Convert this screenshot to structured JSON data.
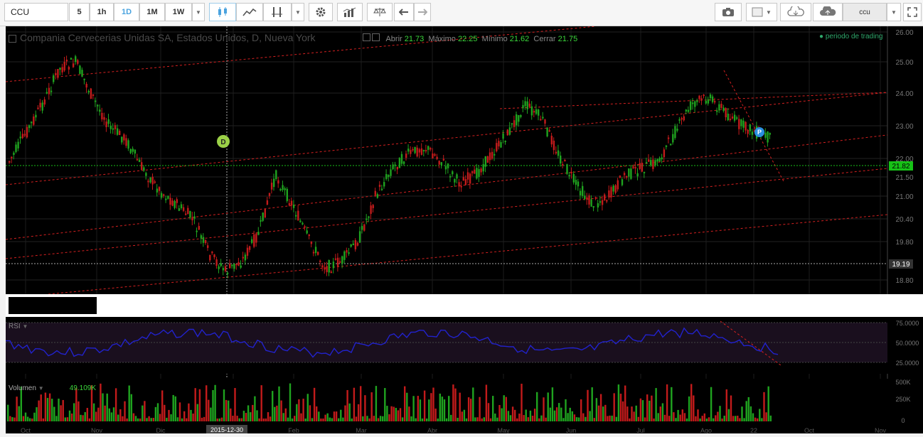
{
  "toolbar": {
    "symbol_value": "CCU",
    "intervals": [
      "5",
      "1h",
      "1D",
      "1M",
      "1W"
    ],
    "active_interval": "1D",
    "compare_label": "ccu"
  },
  "chart": {
    "title": "Compania Cervecerias Unidas SA, Estados Unidos, D, Nueva York",
    "ohlc": {
      "open_label": "Abrir",
      "open": "21.73",
      "high_label": "Máximo",
      "high": "22.25",
      "low_label": "Mínimo",
      "low": "21.62",
      "close_label": "Cerrar",
      "close": "21.75"
    },
    "session_label": "periodo de trading",
    "price_axis": [
      "26.00",
      "25.00",
      "24.00",
      "23.00",
      "22.00",
      "21.50",
      "21.00",
      "20.40",
      "19.80",
      "18.80"
    ],
    "last_price": "21.82",
    "crosshair_price": "19.19",
    "crosshair_date": "2015-12-30",
    "markers": [
      "D",
      "P"
    ],
    "months": [
      "Oct",
      "Nov",
      "Dic",
      "Ene",
      "Feb",
      "Mar",
      "Abr",
      "May",
      "Jun",
      "Jul",
      "Ago",
      "22",
      "Oct",
      "Nov"
    ]
  },
  "rsi": {
    "label": "RSI",
    "axis": [
      "75.0000",
      "50.0000",
      "25.0000"
    ]
  },
  "volume": {
    "label": "Volumen",
    "value": "49.109K",
    "axis": [
      "500K",
      "250K",
      "0"
    ]
  },
  "colors": {
    "up": "#1fa31f",
    "down": "#c21b1b",
    "trend": "#d42020",
    "rsi_line": "#2222cc",
    "last_price_bg": "#16c216"
  }
}
